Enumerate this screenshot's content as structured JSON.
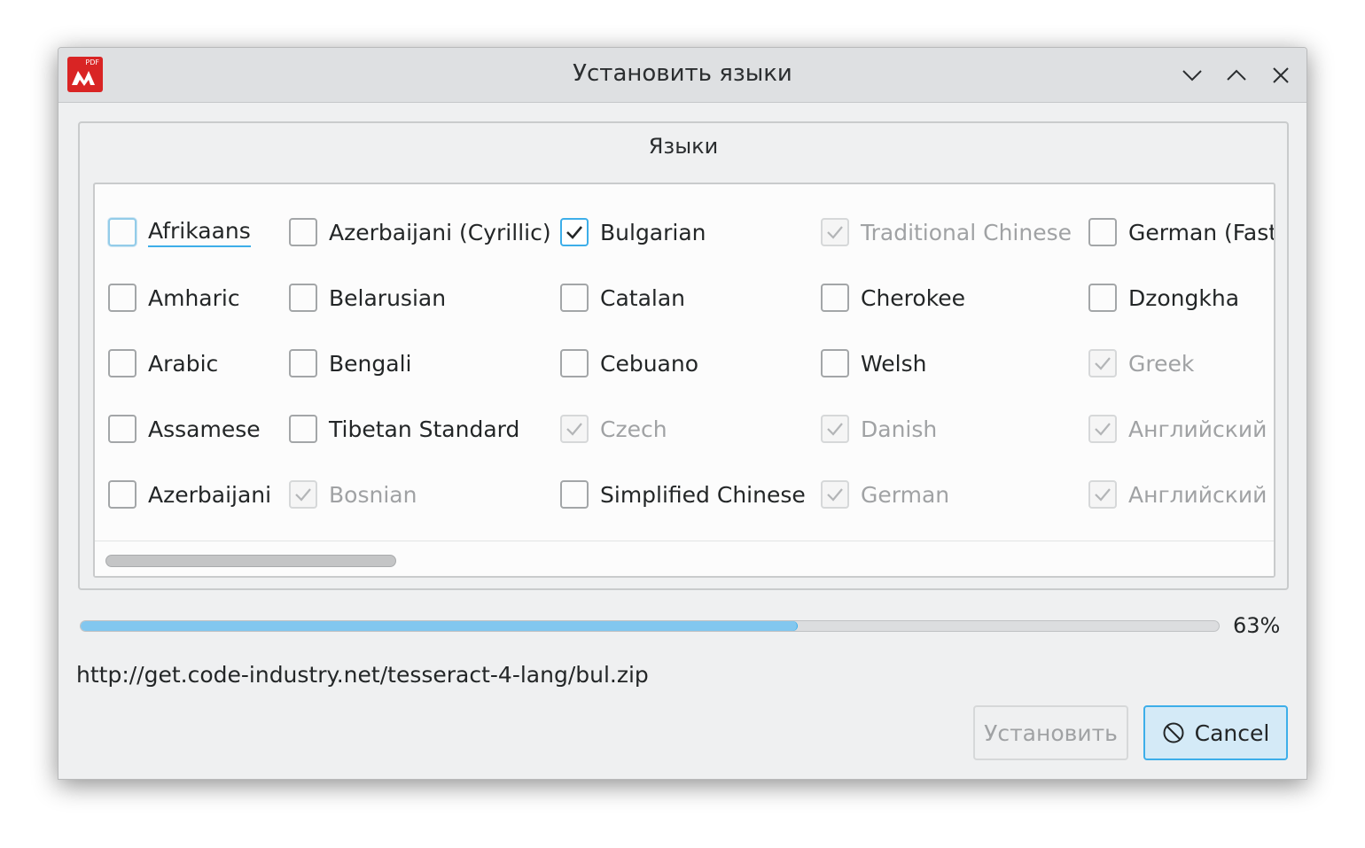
{
  "window": {
    "title": "Установить языки",
    "app_icon_badge": "PDF"
  },
  "group": {
    "title": "Языки"
  },
  "languages": [
    {
      "label": "Afrikaans",
      "state": "unchecked",
      "focused": true
    },
    {
      "label": "Amharic",
      "state": "unchecked"
    },
    {
      "label": "Arabic",
      "state": "unchecked"
    },
    {
      "label": "Assamese",
      "state": "unchecked"
    },
    {
      "label": "Azerbaijani",
      "state": "unchecked"
    },
    {
      "label": "Azerbaijani (Cyrillic)",
      "state": "unchecked"
    },
    {
      "label": "Belarusian",
      "state": "unchecked"
    },
    {
      "label": "Bengali",
      "state": "unchecked"
    },
    {
      "label": "Tibetan Standard",
      "state": "unchecked"
    },
    {
      "label": "Bosnian",
      "state": "installed"
    },
    {
      "label": "Bulgarian",
      "state": "checked"
    },
    {
      "label": "Catalan",
      "state": "unchecked"
    },
    {
      "label": "Cebuano",
      "state": "unchecked"
    },
    {
      "label": "Czech",
      "state": "installed"
    },
    {
      "label": "Simplified Chinese",
      "state": "unchecked"
    },
    {
      "label": "Traditional Chinese",
      "state": "installed"
    },
    {
      "label": "Cherokee",
      "state": "unchecked"
    },
    {
      "label": "Welsh",
      "state": "unchecked"
    },
    {
      "label": "Danish",
      "state": "installed"
    },
    {
      "label": "German",
      "state": "installed"
    },
    {
      "label": "German (Fast",
      "state": "unchecked"
    },
    {
      "label": "Dzongkha",
      "state": "unchecked"
    },
    {
      "label": "Greek",
      "state": "installed"
    },
    {
      "label": "Английский",
      "state": "installed"
    },
    {
      "label": "Английский (",
      "state": "installed"
    }
  ],
  "progress": {
    "value": 0.63,
    "label": "63%"
  },
  "status_url": "http://get.code-industry.net/tesseract-4-lang/bul.zip",
  "buttons": {
    "install_label": "Установить",
    "cancel_label": "Cancel"
  },
  "colors": {
    "accent": "#3daee9",
    "app_icon": "#d92424",
    "disabled_text": "#a0a2a4"
  }
}
